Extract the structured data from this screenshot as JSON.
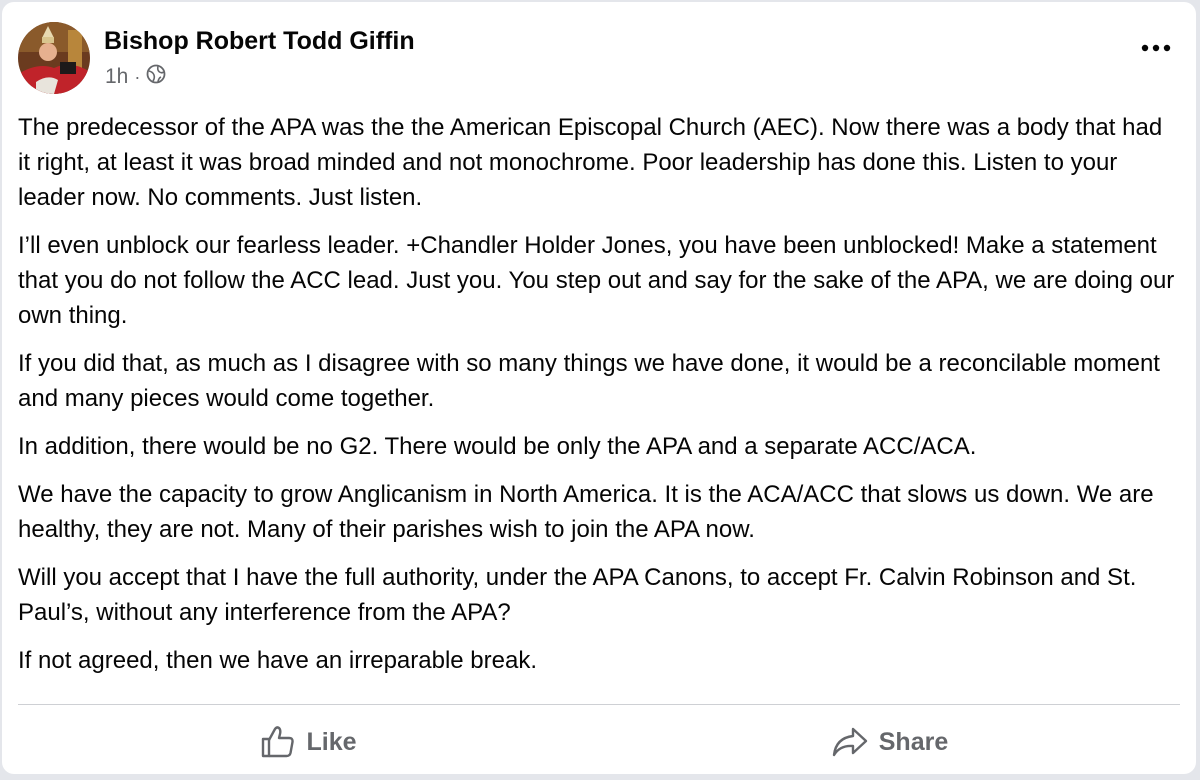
{
  "post": {
    "author": "Bishop Robert Todd Giffin",
    "time": "1h",
    "separator": "·",
    "audience_icon": "globe-icon",
    "more_icon": "more-options-icon",
    "paragraphs": [
      "The predecessor of the APA was the the American Episcopal Church (AEC). Now there was a body that had it right, at least it was broad minded and not monochrome. Poor leadership has done this. Listen to your leader now. No comments. Just listen.",
      "I’ll even unblock our fearless leader. +Chandler Holder Jones, you have been unblocked! Make a statement that you do not follow the ACC lead. Just you. You step out and say for the sake of the APA, we are doing our own thing.",
      "If you did that, as much as I disagree with so many things we have done, it would be a reconcilable moment and many pieces would come together.",
      "In addition, there would be no G2. There would be only the APA and a separate ACC/ACA.",
      "We have the capacity to grow Anglicanism in North America. It is the ACA/ACC that slows us down. We are healthy, they are not. Many of their parishes wish to join the APA now.",
      "Will you accept that I have the full authority, under the APA Canons, to accept Fr. Calvin Robinson and St. Paul’s, without any interference from the APA?",
      "If not agreed, then we have an irreparable break."
    ]
  },
  "actions": {
    "like_label": "Like",
    "share_label": "Share"
  },
  "colors": {
    "background": "#e4e6eb",
    "card": "#ffffff",
    "text": "#050505",
    "secondary_text": "#65676b",
    "divider": "#ced0d4"
  }
}
